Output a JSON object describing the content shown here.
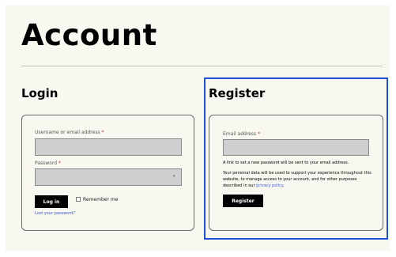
{
  "page": {
    "title": "Account"
  },
  "login": {
    "heading": "Login",
    "username_label": "Username or email address",
    "password_label": "Password",
    "required_mark": "*",
    "login_button": "Log in",
    "remember_me": "Remember me",
    "lost_password": "Lost your password?"
  },
  "register": {
    "heading": "Register",
    "email_label": "Email address",
    "required_mark": "*",
    "info_text": "A link to set a new password will be sent to your email address.",
    "privacy_text_before": "Your personal data will be used to support your experience throughout this website, to manage access to your account, and for other purposes described in our ",
    "privacy_link": "privacy policy",
    "privacy_text_after": ".",
    "register_button": "Register"
  },
  "colors": {
    "page_background": "#f8f7f0",
    "field_fill": "#cfcfcf",
    "button_fill": "#000000",
    "link": "#3a5bd8",
    "highlight_border": "#1f4fd8",
    "required_star": "#d22222"
  },
  "icons": {
    "password_visibility": "eye-icon"
  }
}
